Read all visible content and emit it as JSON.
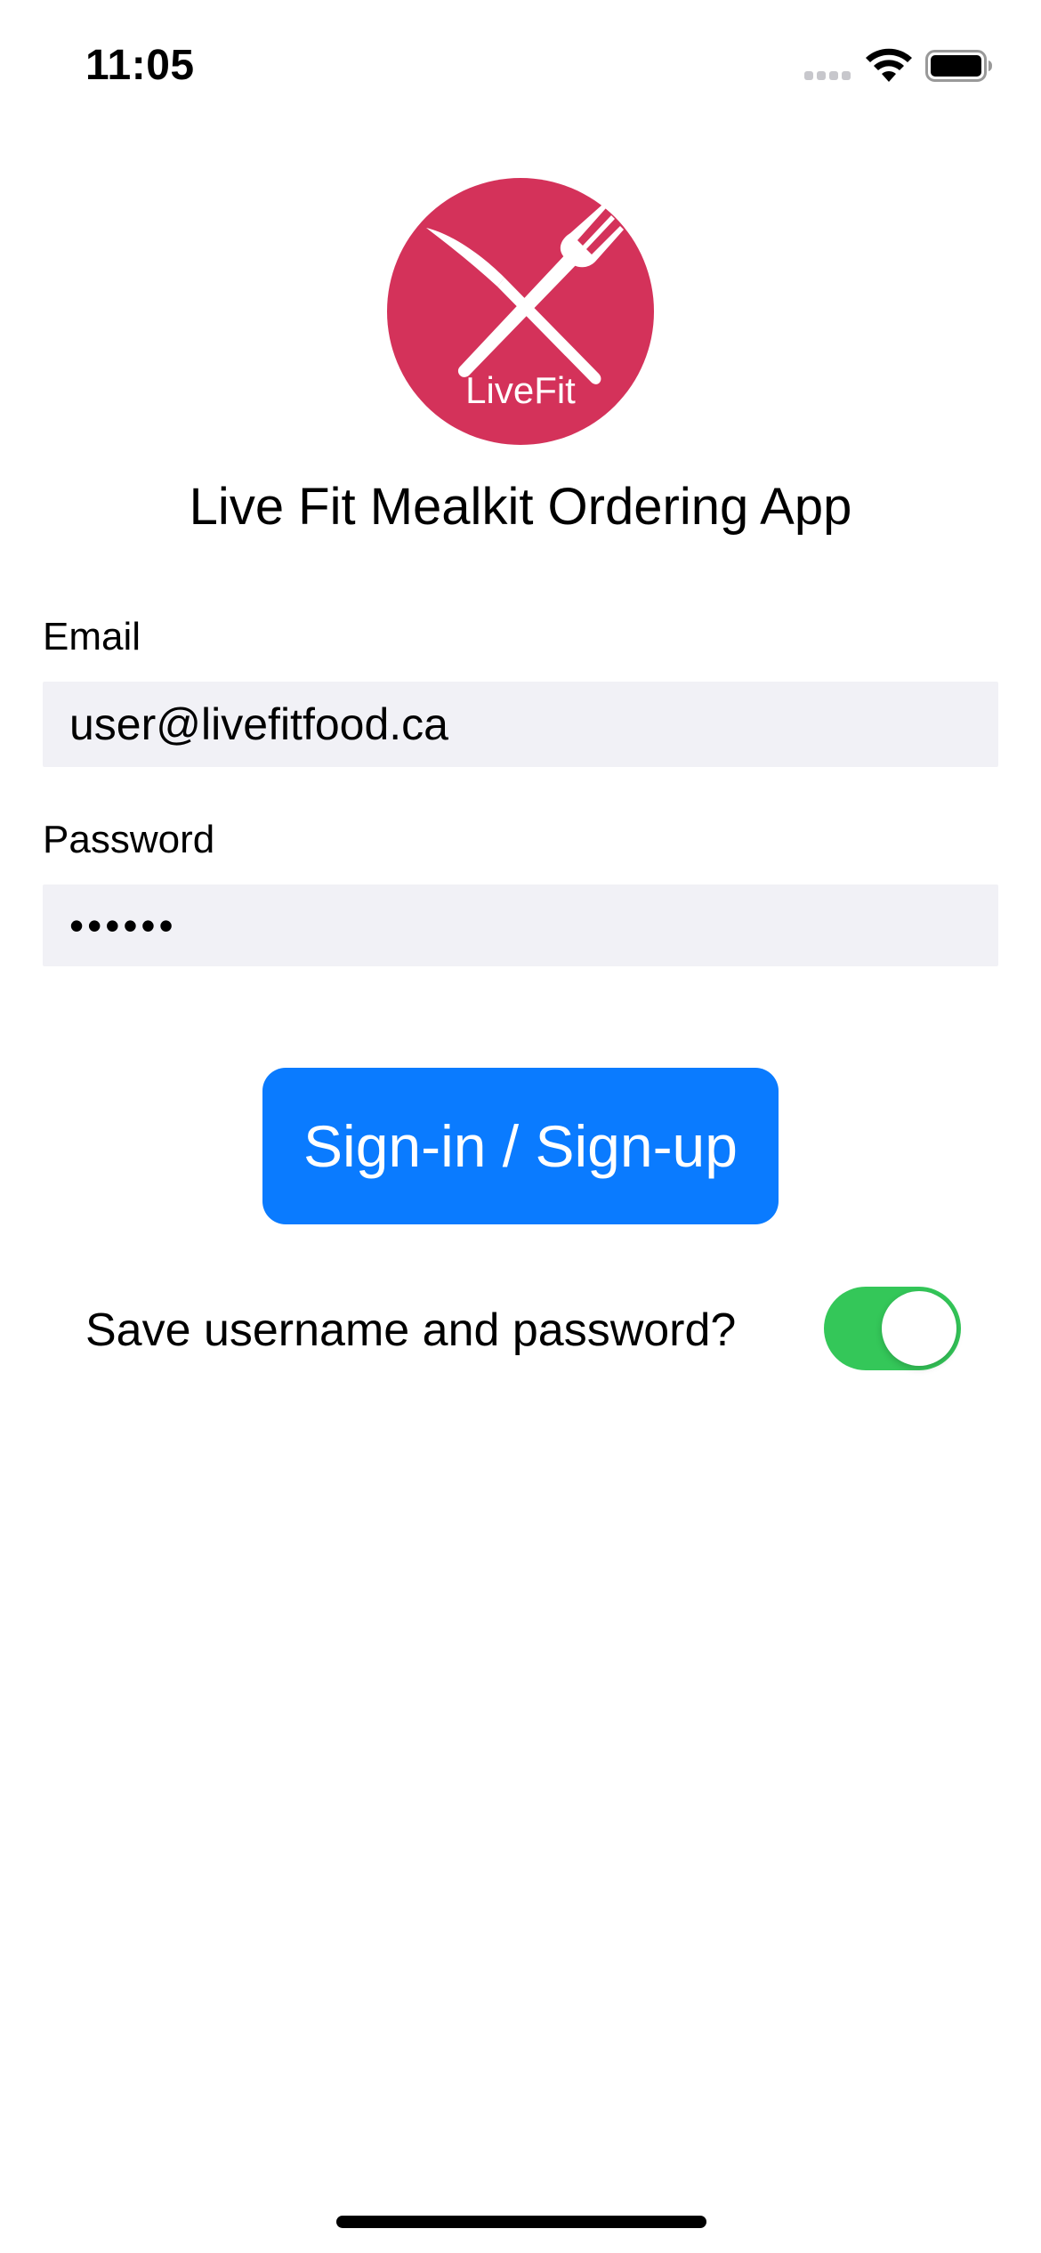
{
  "status_bar": {
    "time": "11:05",
    "icons": [
      "cell-signal-icon",
      "wifi-icon",
      "battery-icon"
    ]
  },
  "logo": {
    "text": "LiveFit",
    "icon": "knife-and-fork-icon",
    "color": "#d4325a"
  },
  "app_title": "Live Fit Mealkit Ordering App",
  "form": {
    "email_label": "Email",
    "email_value": "user@livefitfood.ca",
    "password_label": "Password",
    "password_value": "••••••"
  },
  "signin_button_label": "Sign-in / Sign-up",
  "save_credentials": {
    "label": "Save username and password?",
    "enabled": true
  },
  "colors": {
    "accent": "#0a7bff",
    "toggle_on": "#34c759",
    "field_background": "#f1f1f6"
  }
}
